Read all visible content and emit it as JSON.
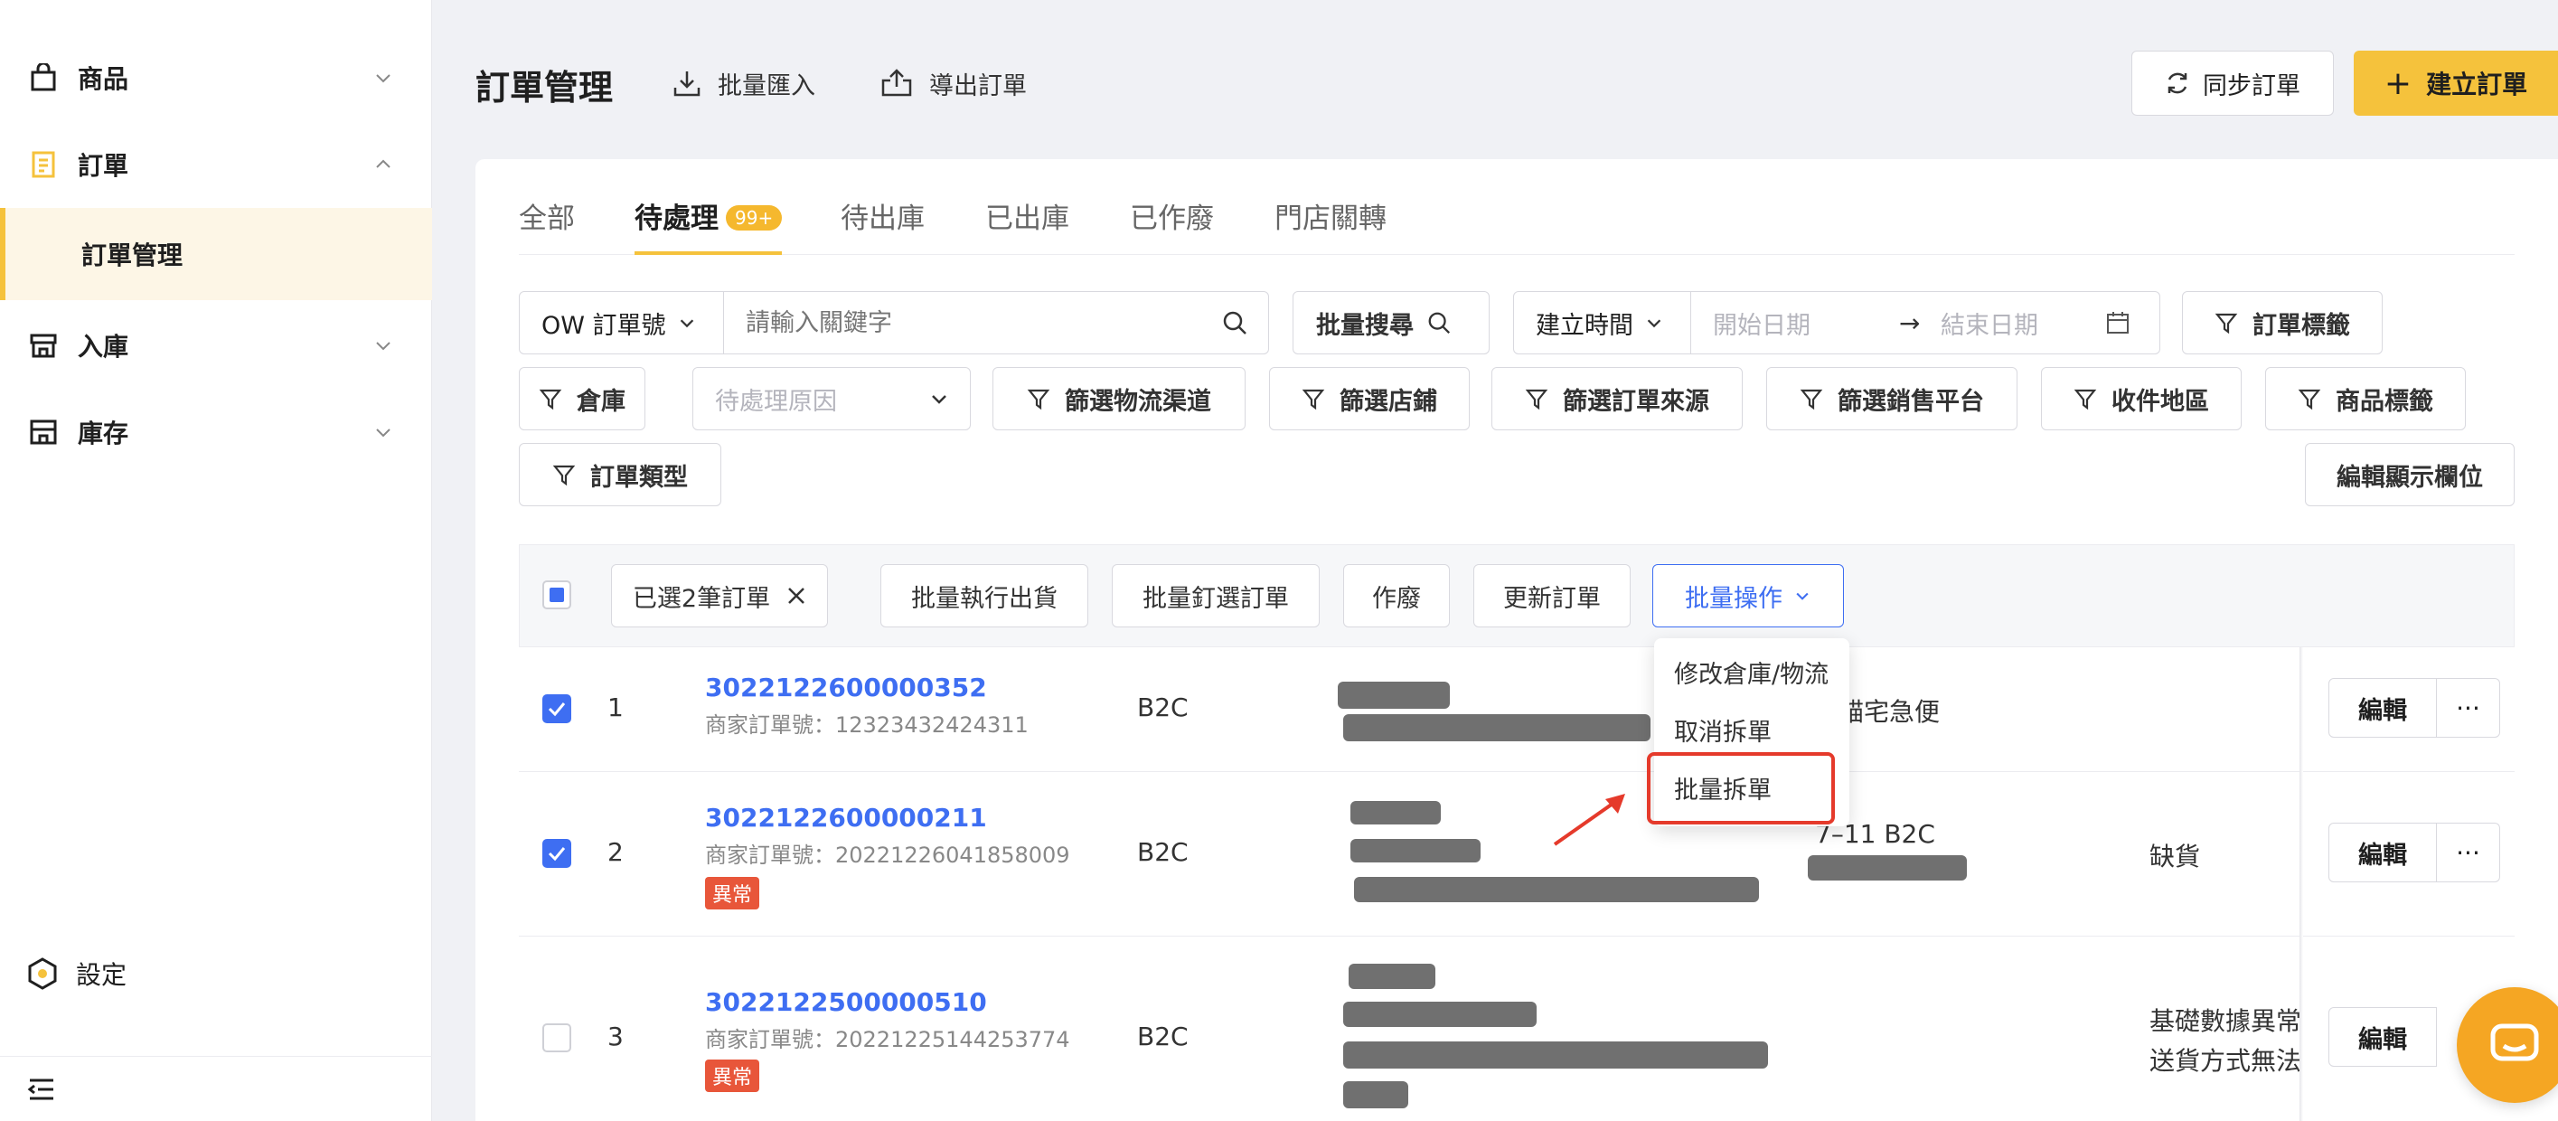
{
  "sidebar": {
    "items": [
      {
        "label": "商品"
      },
      {
        "label": "訂單"
      },
      {
        "label": "入庫"
      },
      {
        "label": "庫存"
      }
    ],
    "sub_item": "訂單管理",
    "settings": "設定"
  },
  "header": {
    "title": "訂單管理",
    "import": "批量匯入",
    "export": "導出訂單",
    "sync": "同步訂單",
    "create": "建立訂單"
  },
  "tabs": [
    {
      "label": "全部"
    },
    {
      "label": "待處理",
      "badge": "99+"
    },
    {
      "label": "待出庫"
    },
    {
      "label": "已出庫"
    },
    {
      "label": "已作廢"
    },
    {
      "label": "門店關轉"
    }
  ],
  "filters": {
    "order_type_select": "OW 訂單號",
    "keyword_placeholder": "請輸入關鍵字",
    "batch_search": "批量搜尋",
    "time_select": "建立時間",
    "start_placeholder": "開始日期",
    "end_placeholder": "結束日期",
    "order_tag": "訂單標籤",
    "warehouse": "倉庫",
    "pending_reason_placeholder": "待處理原因",
    "logistics": "篩選物流渠道",
    "store": "篩選店鋪",
    "order_source": "篩選訂單來源",
    "sales_platform": "篩選銷售平台",
    "region": "收件地區",
    "product_tag": "商品標籤",
    "order_kind": "訂單類型",
    "edit_columns": "編輯顯示欄位"
  },
  "bulk": {
    "selected": "已選2筆訂單",
    "ship": "批量執行出貨",
    "pin": "批量釘選訂單",
    "void": "作廢",
    "update": "更新訂單",
    "ops": "批量操作"
  },
  "dropdown": {
    "items": [
      "修改倉庫/物流",
      "取消拆單",
      "批量拆單"
    ]
  },
  "rows": [
    {
      "idx": "1",
      "order_no": "3022122600000352",
      "merchant": "商家訂單號：12323432424311",
      "type": "B2C",
      "logistics": "黑貓宅急便",
      "status": "",
      "status2": "",
      "error": ""
    },
    {
      "idx": "2",
      "order_no": "3022122600000211",
      "merchant": "商家訂單號：20221226041858009",
      "type": "B2C",
      "logistics": "7–11 B2C",
      "status": "缺貨",
      "status2": "",
      "error": "異常"
    },
    {
      "idx": "3",
      "order_no": "3022122500000510",
      "merchant": "商家訂單號：20221225144253774",
      "type": "B2C",
      "logistics": "",
      "status": "基礎數據異常",
      "status2": "送貨方式無法",
      "error": "異常"
    }
  ],
  "row_actions": {
    "edit": "編輯",
    "more": "···"
  },
  "colors": {
    "accent": "#f5c23c",
    "link": "#3e6ef2",
    "error": "#e8563a",
    "highlight": "#e53a2b"
  }
}
